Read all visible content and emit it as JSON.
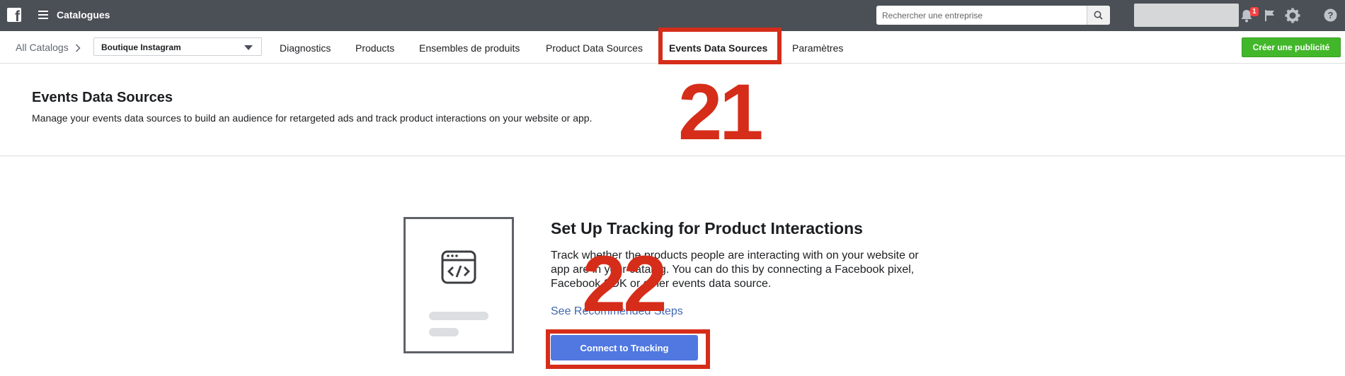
{
  "topbar": {
    "app_title": "Catalogues",
    "search_placeholder": "Rechercher une entreprise",
    "notification_count": "1",
    "icons": [
      "facebook-logo-icon",
      "menu-icon",
      "search-icon",
      "bell-icon",
      "flag-icon",
      "gear-icon",
      "help-icon"
    ]
  },
  "subnav": {
    "breadcrumb": "All Catalogs",
    "catalog_selected": "Boutique Instagram",
    "tabs": [
      {
        "label": "Diagnostics",
        "active": false
      },
      {
        "label": "Products",
        "active": false
      },
      {
        "label": "Ensembles de produits",
        "active": false
      },
      {
        "label": "Product Data Sources",
        "active": false
      },
      {
        "label": "Events Data Sources",
        "active": true
      },
      {
        "label": "Paramètres",
        "active": false
      }
    ],
    "create_ad_label": "Créer une publicité"
  },
  "header": {
    "title": "Events Data Sources",
    "description": "Manage your events data sources to build an audience for retargeted ads and track product interactions on your website or app."
  },
  "setup": {
    "title": "Set Up Tracking for Product Interactions",
    "description": "Track whether the products people are interacting with on your website or app are in your catalog. You can do this by connecting a Facebook pixel, Facebook SDK or other events data source.",
    "link_label": "See Recommended Steps",
    "button_label": "Connect to Tracking"
  },
  "annotations": {
    "step_21": "21",
    "step_22": "22"
  },
  "colors": {
    "topbar": "#4b4f56",
    "annotation_red": "#d52d19",
    "primary_button": "#5078e0",
    "create_button": "#42b72a",
    "link": "#4267b2"
  }
}
